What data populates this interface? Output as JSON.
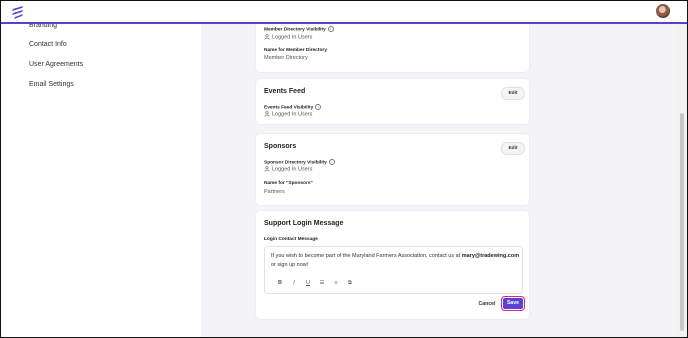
{
  "sidebar": {
    "items": [
      {
        "label": "Branding"
      },
      {
        "label": "Contact Info"
      },
      {
        "label": "User Agreements"
      },
      {
        "label": "Email Settings"
      }
    ]
  },
  "member_directory": {
    "visibility_label": "Member Directory Visibility",
    "visibility_value": "Logged In Users",
    "name_label": "Name for Member Directory",
    "name_value": "Member Directory"
  },
  "events_feed": {
    "title": "Events Feed",
    "edit_label": "Edit",
    "visibility_label": "Events Feed Visibility",
    "visibility_value": "Logged In Users"
  },
  "sponsors": {
    "title": "Sponsors",
    "edit_label": "Edit",
    "visibility_label": "Sponsor Directory Visibility",
    "visibility_value": "Logged In Users",
    "name_label": "Name for \"Sponsors\"",
    "name_value": "Partners"
  },
  "support_login": {
    "title": "Support Login Message",
    "field_label": "Login Contact Message",
    "message_before": "If you wish to become part of the Maryland Farmers Association, contact us at ",
    "message_email": "mary@tradewing.com",
    "message_after": " or sign up now!",
    "toolbar": {
      "bold": "B",
      "italic": "I",
      "underline": "U",
      "bullet_list": "☰",
      "numbered_list": "≡",
      "link": "⧉"
    },
    "cancel_label": "Cancel",
    "save_label": "Save"
  },
  "colors": {
    "accent": "#5a43d4",
    "highlight": "#e0218a"
  },
  "icons": [
    "logo-icon",
    "avatar",
    "info-icon",
    "user-icon"
  ]
}
